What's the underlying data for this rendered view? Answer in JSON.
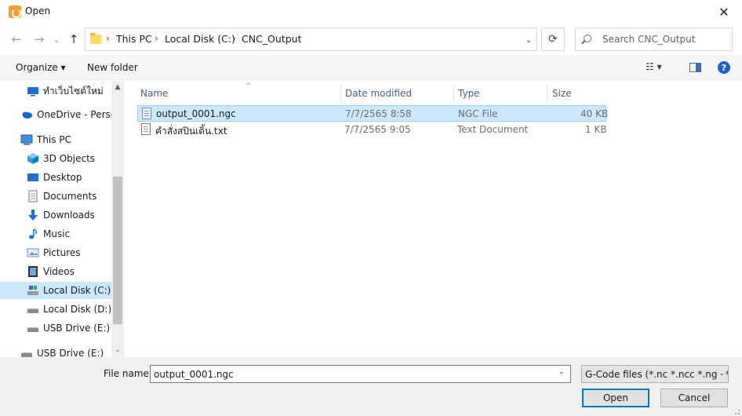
{
  "window": {
    "title": "Open",
    "close_symbol": "✕"
  },
  "nav": {
    "back_symbol": "←",
    "forward_symbol": "→",
    "recent_symbol": "⌄",
    "up_symbol": "↑",
    "breadcrumbs": [
      "This PC",
      "Local Disk (C:)",
      "CNC_Output"
    ],
    "separator": "›",
    "dropdown_symbol": "⌄",
    "refresh_symbol": "⟳"
  },
  "search": {
    "placeholder": "Search CNC_Output"
  },
  "toolbar": {
    "organize": "Organize ▾",
    "new_folder": "New folder",
    "view_symbol": "☷ ▾",
    "help_symbol": "?"
  },
  "sidebar": {
    "items": [
      {
        "label": "ทำเว็บไซต์ใหม่",
        "icon": "monitor-icon"
      },
      {
        "label": "OneDrive - Person",
        "icon": "cloud-icon"
      },
      {
        "label": "This PC",
        "icon": "computer-icon"
      },
      {
        "label": "3D Objects",
        "icon": "cube-icon"
      },
      {
        "label": "Desktop",
        "icon": "desktop-icon"
      },
      {
        "label": "Documents",
        "icon": "document-icon"
      },
      {
        "label": "Downloads",
        "icon": "download-icon"
      },
      {
        "label": "Music",
        "icon": "music-icon"
      },
      {
        "label": "Pictures",
        "icon": "picture-icon"
      },
      {
        "label": "Videos",
        "icon": "video-icon"
      },
      {
        "label": "Local Disk (C:)",
        "icon": "drive-icon"
      },
      {
        "label": "Local Disk (D:)",
        "icon": "drive-icon"
      },
      {
        "label": "USB Drive (E:)",
        "icon": "usb-drive-icon"
      },
      {
        "label": "USB Drive (E:)",
        "icon": "usb-drive-icon"
      }
    ],
    "selected_index": 10,
    "scroll_up_symbol": "▲",
    "scroll_down_symbol": "⌄"
  },
  "columns": {
    "name": "Name",
    "date": "Date modified",
    "type": "Type",
    "size": "Size",
    "sort_symbol": "^"
  },
  "files": [
    {
      "name": "output_0001.ngc",
      "date": "7/7/2565 8:58",
      "type": "NGC File",
      "size": "40 KB",
      "selected": true
    },
    {
      "name": "คำสั่งสปินเดิ้น.txt",
      "date": "7/7/2565 9:05",
      "type": "Text Document",
      "size": "1 KB",
      "selected": false
    }
  ],
  "bottom": {
    "file_name_label": "File name:",
    "file_name_value": "output_0001.ngc",
    "dropdown_symbol": "⌄",
    "filter": "G-Code files (*.nc *.ncc *.ngc *.",
    "open": "Open",
    "cancel": "Cancel"
  },
  "colors": {
    "accent": "#0078d7",
    "selection": "#cce8ff",
    "folder": "#ffd865"
  }
}
